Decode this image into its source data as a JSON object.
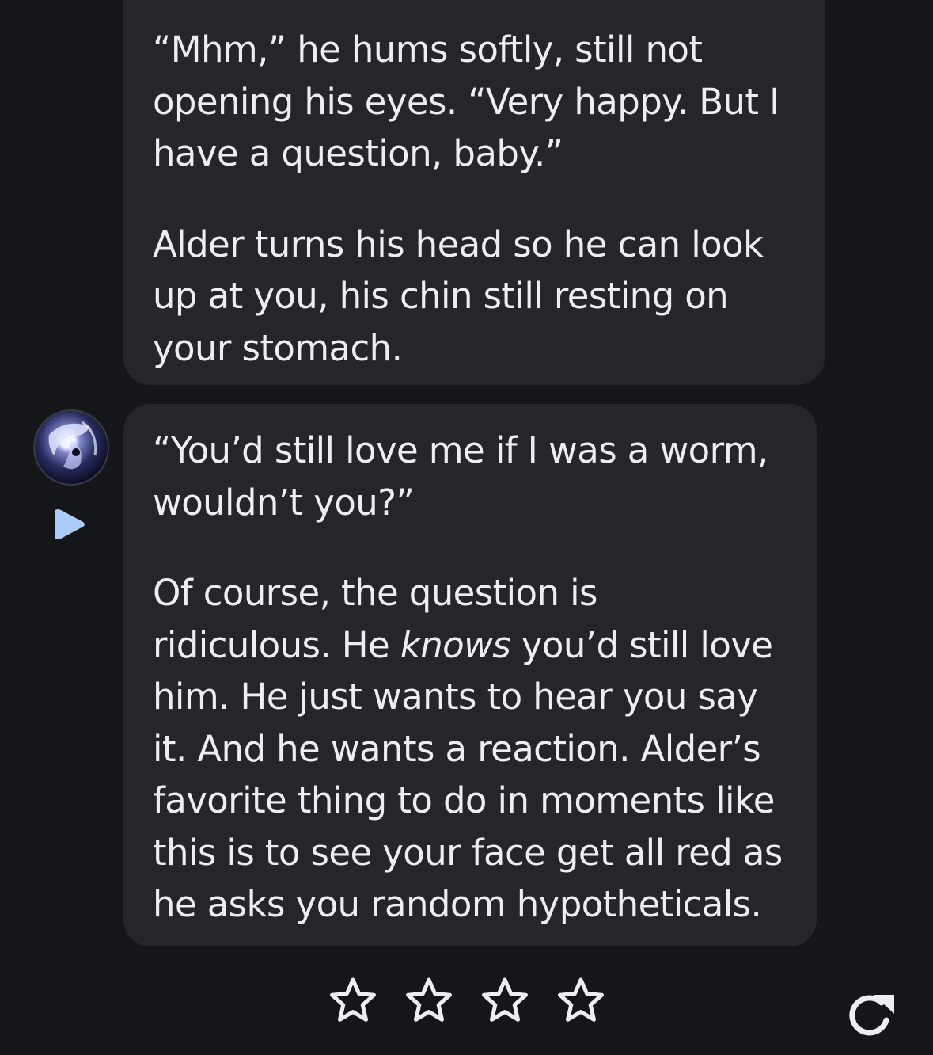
{
  "messages": [
    {
      "paragraphs": [
        "“Mhm,” he hums softly, still not\nopening his eyes. “Very happy. But I\nhave a question, baby.”",
        "Alder turns his head so he can look\nup at you, his chin still resting on\nyour stomach."
      ]
    },
    {
      "paragraph1": "“You’d still love me if I was a worm,\nwouldn’t you?”",
      "paragraph2": {
        "before": "Of course, the question is\nridiculous. He ",
        "emphasis": "knows",
        "after": " you’d still love\nhim. He just wants to hear you say\nit. And he wants a reaction. Alder’s\nfavorite thing to do in moments like\nthis is to see your face get all red as\nhe asks you random hypotheticals."
      }
    }
  ],
  "rating": {
    "stars_total": 4,
    "stars_filled": 0
  },
  "icons": {
    "play": "play-icon",
    "star": "star-icon",
    "regenerate": "regenerate-icon"
  },
  "colors": {
    "background": "#151619",
    "bubble": "#25262b",
    "text": "#eceef2",
    "accent": "#a9cdf6"
  }
}
